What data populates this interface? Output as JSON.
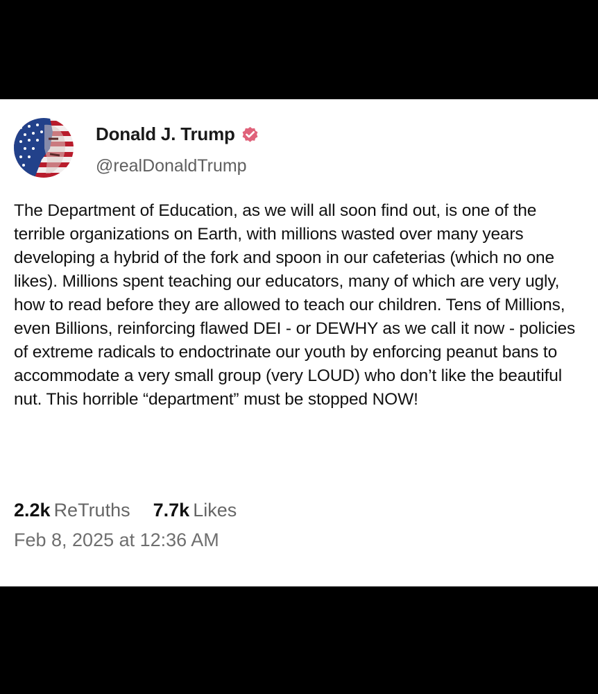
{
  "post": {
    "author": {
      "display_name": "Donald J. Trump",
      "handle": "@realDonaldTrump",
      "verified": true,
      "verified_color": "#e0627a"
    },
    "body": "The Department of Education, as we will all soon find out, is one of the terrible organizations on Earth, with millions wasted over many years developing a hybrid of the fork and spoon in our cafeterias (which no one likes). Millions spent teaching our educators, many of which are very ugly, how to read before they are allowed to teach our children. Tens of Millions, even Billions, reinforcing flawed DEI - or DEWHY as we call it now - policies of extreme radicals to endoctrinate our youth by enforcing peanut bans to accommodate a very small group (very LOUD) who don’t like the beautiful nut. This horrible “department” must be stopped NOW!",
    "stats": {
      "retruths_count": "2.2k",
      "retruths_label": "ReTruths",
      "likes_count": "7.7k",
      "likes_label": "Likes"
    },
    "timestamp": "Feb 8, 2025 at 12:36 AM"
  },
  "icons": {
    "avatar": "avatar-flag-portrait",
    "verified": "verified-badge-icon"
  },
  "colors": {
    "frame_background": "#000000",
    "card_background": "#ffffff"
  }
}
